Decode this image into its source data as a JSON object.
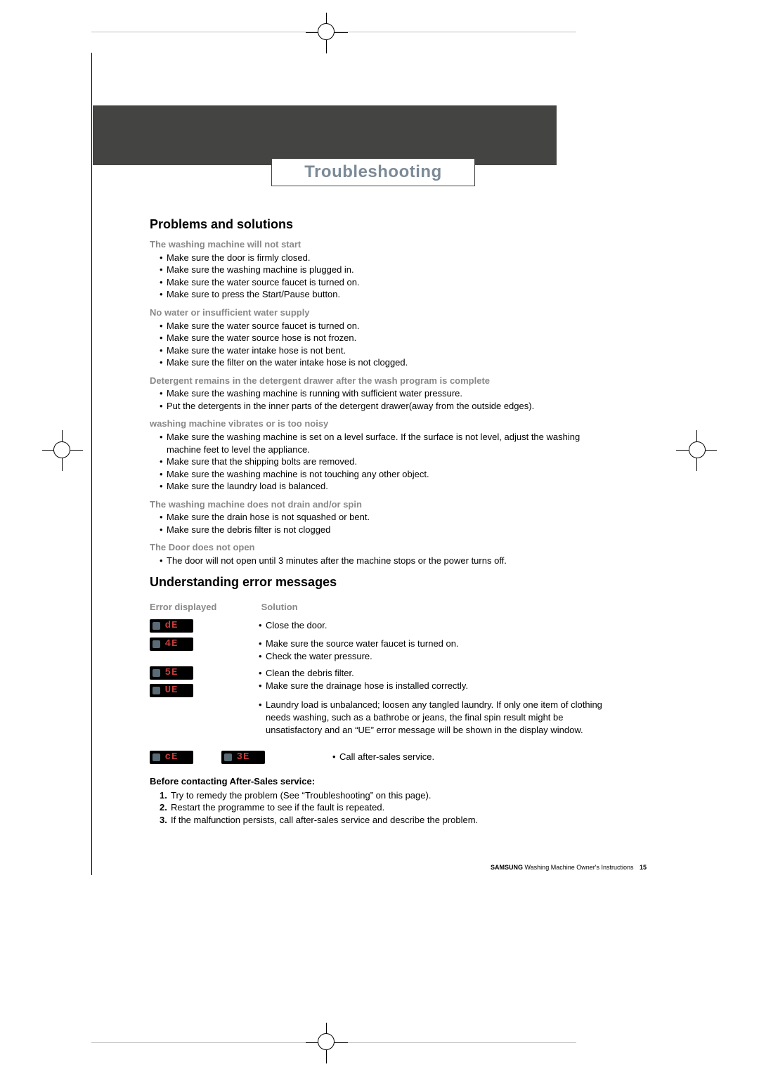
{
  "title": "Troubleshooting",
  "section1": {
    "heading": "Problems and solutions",
    "groups": [
      {
        "sub": "The washing machine will not start",
        "items": [
          "Make sure the door is firmly closed.",
          "Make sure the washing machine is plugged in.",
          "Make sure the water source faucet is turned on.",
          "Make sure to press the Start/Pause button."
        ]
      },
      {
        "sub": "No water or insufficient water supply",
        "items": [
          "Make sure the water source faucet is turned on.",
          "Make sure the water source hose is not frozen.",
          "Make sure the water intake hose is not bent.",
          "Make sure the filter on the water intake hose is not clogged."
        ]
      },
      {
        "sub": "Detergent remains in the detergent drawer after the wash program is complete",
        "items": [
          "Make sure the washing machine is running with sufficient water pressure.",
          "Put the detergents in the inner parts of the detergent drawer(away from the outside edges)."
        ]
      },
      {
        "sub": "washing machine vibrates or is too noisy",
        "items": [
          "Make sure the washing machine is set on a level surface. If the surface is not level, adjust the washing machine feet to level the appliance.",
          "Make sure that the shipping bolts are removed.",
          "Make sure the washing machine is not touching any other object.",
          "Make sure the laundry load is balanced."
        ]
      },
      {
        "sub": "The washing machine does not drain and/or spin",
        "items": [
          "Make sure the drain hose is not squashed or bent.",
          "Make sure the debris filter is not clogged"
        ]
      },
      {
        "sub": "The Door does not open",
        "items": [
          "The door will not open until 3 minutes after the machine stops or the power turns off."
        ]
      }
    ]
  },
  "section2": {
    "heading": "Understanding error messages",
    "col1": "Error displayed",
    "col2": "Solution",
    "rows": [
      {
        "codes": [
          "dE"
        ],
        "sol": [
          "Close the door."
        ]
      },
      {
        "codes": [
          "4E"
        ],
        "sol": [
          "Make sure the source water faucet is turned on.",
          "Check the water pressure."
        ]
      },
      {
        "codes": [
          "5E",
          "UE"
        ],
        "stacked": true,
        "sol": [
          "Clean the debris filter.",
          "Make sure the drainage hose is installed correctly.",
          "Laundry load is unbalanced; loosen any tangled laundry. If only one item of clothing needs washing, such as a bathrobe or jeans, the final spin result might be unsatisfactory and an “UE” error message will be shown in the display window."
        ]
      },
      {
        "codes": [
          "cE",
          "3E"
        ],
        "sol": [
          "Call after-sales service."
        ]
      }
    ]
  },
  "before": {
    "heading": "Before contacting After-Sales service:",
    "items": [
      "Try to remedy the problem (See “Troubleshooting” on this page).",
      "Restart the programme to see if the fault is repeated.",
      "If the malfunction persists, call after-sales service and describe the problem."
    ]
  },
  "footer": {
    "brand": "SAMSUNG",
    "text": "Washing Machine Owner's Instructions",
    "page": "15"
  }
}
